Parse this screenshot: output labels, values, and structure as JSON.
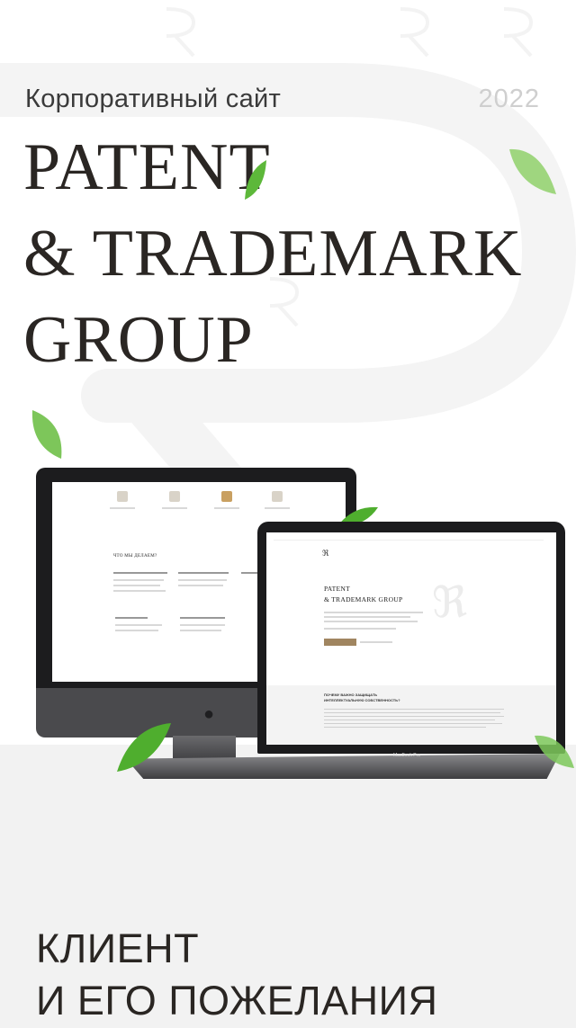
{
  "header": {
    "subtitle": "Корпоративный сайт",
    "year": "2022"
  },
  "brand": {
    "lines": [
      "PATENT",
      "& TRADEMARK",
      "GROUP"
    ]
  },
  "laptop": {
    "model_label": "MacBook Pro",
    "site_title_1": "PATENT",
    "site_title_2": "& TRADEMARK GROUP",
    "section_title_1": "ПОЧЕМУ ВАЖНО ЗАЩИЩАТЬ",
    "section_title_2": "ИНТЕЛЛЕКТУАЛЬНУЮ СОБСТВЕННОСТЬ?"
  },
  "imac": {
    "section_title": "ЧТО МЫ ДЕЛАЕМ?"
  },
  "footer": {
    "line1": "КЛИЕНТ",
    "line2": "И ЕГО ПОЖЕЛАНИЯ"
  },
  "colors": {
    "accent": "#a08560",
    "leaf": "#5db83a",
    "background_panel": "#f2f2f2"
  }
}
